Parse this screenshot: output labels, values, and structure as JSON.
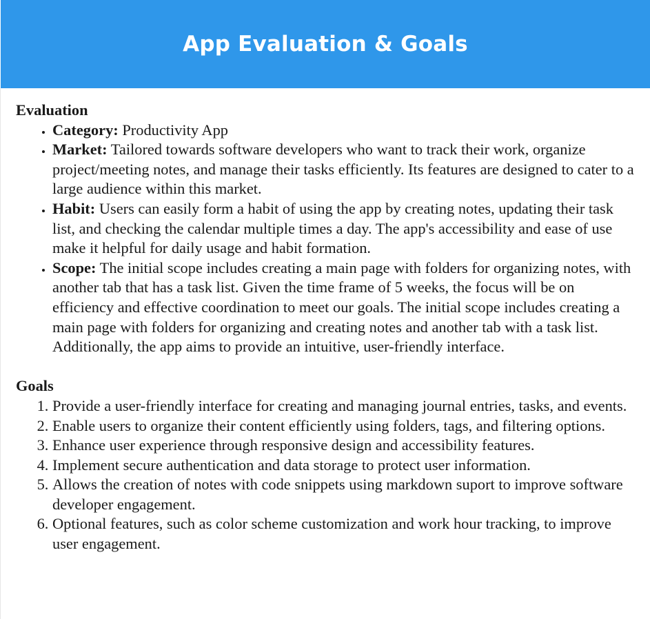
{
  "header": {
    "title": "App Evaluation & Goals",
    "background_color": "#2f97ea"
  },
  "evaluation": {
    "heading": "Evaluation",
    "items": [
      {
        "label": "Category:",
        "text": "Productivity App"
      },
      {
        "label": "Market:",
        "text": "Tailored towards software developers who want to track their work, organize project/meeting notes, and manage their tasks efficiently. Its features are designed to cater to a large audience within this market."
      },
      {
        "label": "Habit:",
        "text": "Users can easily form a habit of using the app by creating notes, updating their task list, and checking the calendar multiple times a day. The app's accessibility and ease of use make it helpful for daily usage and habit formation."
      },
      {
        "label": "Scope:",
        "text": "The initial scope includes creating a main page with folders for organizing notes, with another tab that has a task list. Given the time frame of 5 weeks, the focus will be on efficiency and effective coordination to meet our goals. The initial scope includes creating a main page with folders for organizing and creating notes and another tab with a task list. Additionally, the app aims to provide an intuitive, user-friendly interface."
      }
    ]
  },
  "goals": {
    "heading": "Goals",
    "items": [
      "Provide a user-friendly interface for creating and managing journal entries, tasks, and events.",
      "Enable users to organize their content efficiently using folders, tags, and filtering options.",
      "Enhance user experience through responsive design and accessibility features.",
      "Implement secure authentication and data storage to protect user information.",
      "Allows the creation of notes with code snippets using markdown suport to improve software developer engagement.",
      "Optional features, such as color scheme customization and work hour tracking, to improve user engagement."
    ]
  }
}
